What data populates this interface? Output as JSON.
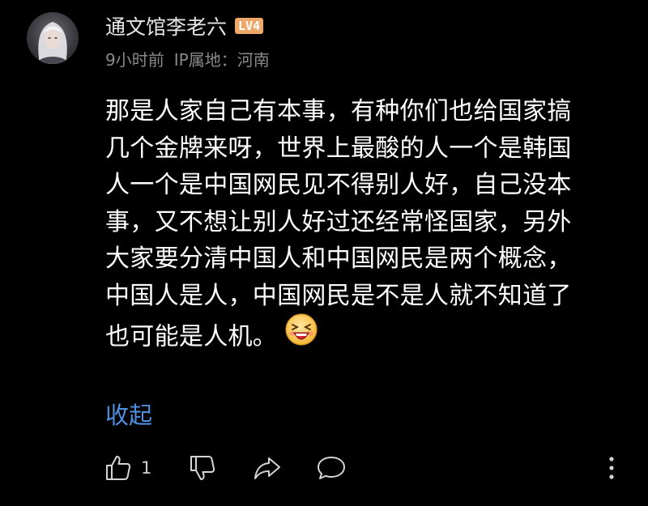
{
  "user": {
    "name": "通文馆李老六",
    "level": "LV4",
    "time": "9小时前",
    "ip_location": "IP属地：河南"
  },
  "comment": {
    "lines": [
      "那是人家自己有本事，有种你们也给国家搞",
      "几个金牌来呀，世界上最酸的人一个是韩国",
      "人一个是中国网民见不得别人好，自己没本",
      "事，又不想让别人好过还经常怪国家，另外",
      "大家要分清中国人和中国网民是两个概念，",
      "中国人是人，中国网民是不是人就不知道了",
      "也可能是人机。"
    ],
    "emoji": "grin-emoji",
    "collapse_label": "收起"
  },
  "actions": {
    "like_count": "1",
    "icons": [
      "thumbs-up-icon",
      "thumbs-down-icon",
      "share-icon",
      "comment-icon",
      "more-vertical-icon"
    ]
  },
  "colors": {
    "background": "#000000",
    "text": "#ffffff",
    "meta": "#8a8a8a",
    "link": "#4f8fe0",
    "badge": "#f0a86a"
  }
}
